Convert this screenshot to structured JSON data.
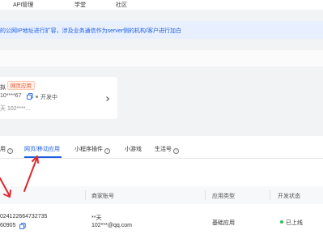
{
  "topnav": {
    "items": [
      "API管理",
      "学堂",
      "社区"
    ]
  },
  "notice": {
    "text": "的公网IP地址进行扩容，涉及业务通信作为server侧的机构/客户进行加白"
  },
  "app_card": {
    "name_fragment": "拟",
    "type_tag": "网页应用",
    "appid": "10****67",
    "status": "开发中",
    "owner": "天 102****..."
  },
  "tabs": [
    {
      "label": "用",
      "info": true,
      "active": false
    },
    {
      "label": "网页/移动应用",
      "info": false,
      "active": true
    },
    {
      "label": "小程序插件",
      "info": true,
      "active": false
    },
    {
      "label": "小游戏",
      "info": false,
      "active": false
    },
    {
      "label": "生活号",
      "info": true,
      "active": false
    }
  ],
  "table": {
    "headers": [
      "",
      "商家账号",
      "应用类型",
      "开发状态"
    ],
    "row": {
      "appid_line1": "024122664732735",
      "appid_line2": "60905",
      "merchant_name": "**天",
      "merchant_email": "102***@qq.com",
      "app_type": "基础应用",
      "dev_status": "已上线"
    }
  },
  "colors": {
    "accent": "#1b5de0",
    "arrow": "#e0262c",
    "online": "#2fc25b",
    "tag": "#e0562c"
  }
}
